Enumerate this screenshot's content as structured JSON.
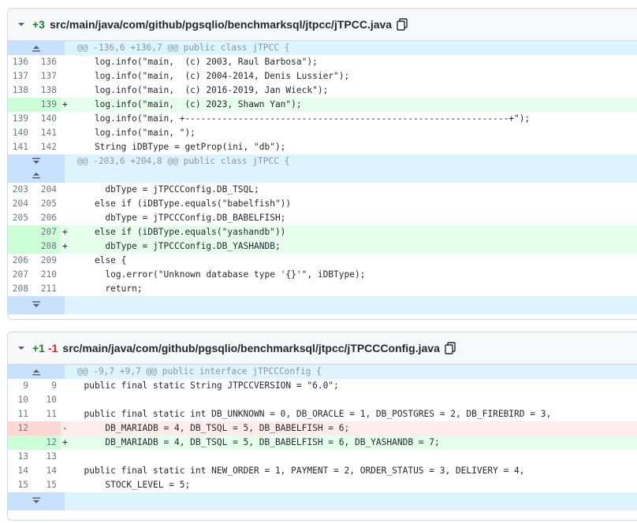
{
  "file1": {
    "added": "+3",
    "path": "src/main/java/com/github/pgsqlio/benchmarksql/jtpcc/jTPCC.java",
    "hunks": [
      "@@ -136,6 +136,7 @@ public class jTPCC {",
      "@@ -203,6 +204,8 @@ public class jTPCC {"
    ],
    "lines": [
      {
        "o": "136",
        "n": "136",
        "s": "",
        "c": "    log.info(\"main,  (c) 2003, Raul Barbosa\");"
      },
      {
        "o": "137",
        "n": "137",
        "s": "",
        "c": "    log.info(\"main,  (c) 2004-2014, Denis Lussier\");"
      },
      {
        "o": "138",
        "n": "138",
        "s": "",
        "c": "    log.info(\"main,  (c) 2016-2019, Jan Wieck\");"
      },
      {
        "o": "",
        "n": "139",
        "s": "+",
        "c": "    log.info(\"main,  (c) 2023, Shawn Yan\");"
      },
      {
        "o": "139",
        "n": "140",
        "s": "",
        "c": "    log.info(\"main, +-------------------------------------------------------------+\");"
      },
      {
        "o": "140",
        "n": "141",
        "s": "",
        "c": "    log.info(\"main, \");"
      },
      {
        "o": "141",
        "n": "142",
        "s": "",
        "c": "    String iDBType = getProp(ini, \"db\");"
      },
      {
        "o": "203",
        "n": "204",
        "s": "",
        "c": "      dbType = jTPCCConfig.DB_TSQL;"
      },
      {
        "o": "204",
        "n": "205",
        "s": "",
        "c": "    else if (iDBType.equals(\"babelfish\"))"
      },
      {
        "o": "205",
        "n": "206",
        "s": "",
        "c": "      dbType = jTPCCConfig.DB_BABELFISH;"
      },
      {
        "o": "",
        "n": "207",
        "s": "+",
        "c": "    else if (iDBType.equals(\"yashandb\"))"
      },
      {
        "o": "",
        "n": "208",
        "s": "+",
        "c": "      dbType = jTPCCConfig.DB_YASHANDB;"
      },
      {
        "o": "206",
        "n": "209",
        "s": "",
        "c": "    else {"
      },
      {
        "o": "207",
        "n": "210",
        "s": "",
        "c": "      log.error(\"Unknown database type '{}'\", iDBType);"
      },
      {
        "o": "208",
        "n": "211",
        "s": "",
        "c": "      return;"
      }
    ]
  },
  "file2": {
    "added": "+1",
    "removed": "-1",
    "path": "src/main/java/com/github/pgsqlio/benchmarksql/jtpcc/jTPCCConfig.java",
    "hunks": [
      "@@ -9,7 +9,7 @@ public interface jTPCCConfig {"
    ],
    "lines": [
      {
        "o": "9",
        "n": "9",
        "s": "",
        "c": "  public final static String JTPCCVERSION = \"6.0\";"
      },
      {
        "o": "10",
        "n": "10",
        "s": "",
        "c": ""
      },
      {
        "o": "11",
        "n": "11",
        "s": "",
        "c": "  public final static int DB_UNKNOWN = 0, DB_ORACLE = 1, DB_POSTGRES = 2, DB_FIREBIRD = 3,"
      },
      {
        "o": "12",
        "n": "",
        "s": "-",
        "c": "      DB_MARIADB = 4, DB_TSQL = 5, DB_BABELFISH = 6;"
      },
      {
        "o": "",
        "n": "12",
        "s": "+",
        "c": "      DB_MARIADB = 4, DB_TSQL = 5, DB_BABELFISH = 6, DB_YASHANDB = 7;"
      },
      {
        "o": "13",
        "n": "13",
        "s": "",
        "c": ""
      },
      {
        "o": "14",
        "n": "14",
        "s": "",
        "c": "  public final static int NEW_ORDER = 1, PAYMENT = 2, ORDER_STATUS = 3, DELIVERY = 4,"
      },
      {
        "o": "15",
        "n": "15",
        "s": "",
        "c": "      STOCK_LEVEL = 5;"
      }
    ]
  },
  "colors": {
    "added_bg": "#e6ffec",
    "added_gutter": "#ccffd8",
    "removed_bg": "#ffebe9",
    "removed_gutter": "#ffd7d5",
    "hunk_bg": "#ddf4ff"
  },
  "icons": [
    "chevron-down-icon",
    "copy-icon",
    "expand-up-icon",
    "expand-down-icon"
  ]
}
